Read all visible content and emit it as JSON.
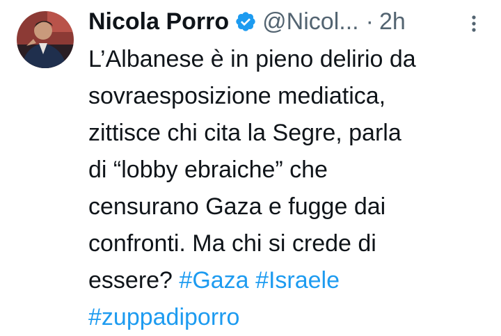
{
  "tweet": {
    "author_name": "Nicola Porro",
    "handle": "@Nicol...",
    "separator": "·",
    "time": "2h",
    "lines": [
      "L’Albanese è in pieno delirio da",
      "sovraesposizione mediatica,",
      "zittisce chi cita la Segre, parla",
      "di “lobby ebraiche” che",
      "censurano Gaza e fugge dai",
      "confronti. Ma chi si crede di"
    ],
    "last_line_text": "essere?",
    "hashtags": [
      "#Gaza",
      "#Israele",
      "#zuppadiporro"
    ]
  },
  "colors": {
    "text": "#0f1419",
    "secondary": "#536471",
    "accent": "#1d9bf0"
  },
  "icons": {
    "verified": "verified-badge-icon",
    "more": "more-options-icon"
  }
}
